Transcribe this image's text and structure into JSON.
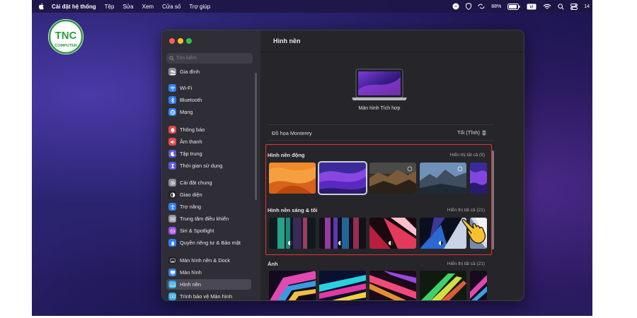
{
  "menubar": {
    "app_name": "Cài đặt hệ thống",
    "menus": [
      "Tệp",
      "Sửa",
      "Xem",
      "Cửa số",
      "Trợ giúp"
    ],
    "battery": "88%",
    "clock": "14"
  },
  "logo": {
    "text": "TNC",
    "sub": "COMPUTER",
    "color": "#2e9a3e"
  },
  "window": {
    "search_placeholder": "Tìm kiếm",
    "sidebar": [
      {
        "label": "Gia đình",
        "icon": "family-icon",
        "color": "#8e8e96"
      },
      {
        "label": "Wi-Fi",
        "icon": "wifi-icon",
        "color": "#2f7ff5"
      },
      {
        "label": "Bluetooth",
        "icon": "bluetooth-icon",
        "color": "#2f7ff5"
      },
      {
        "label": "Mạng",
        "icon": "globe-icon",
        "color": "#2f7ff5"
      },
      {
        "label": "Thông báo",
        "icon": "bell-icon",
        "color": "#e5484d"
      },
      {
        "label": "Âm thanh",
        "icon": "speaker-icon",
        "color": "#e5484d"
      },
      {
        "label": "Tập trung",
        "icon": "moon-icon",
        "color": "#5b5ce0"
      },
      {
        "label": "Thời gian sử dụng",
        "icon": "hourglass-icon",
        "color": "#5b5ce0"
      },
      {
        "label": "Cài đặt chung",
        "icon": "gear-icon",
        "color": "#8e8e96"
      },
      {
        "label": "Giao diện",
        "icon": "appearance-icon",
        "color": "#222226"
      },
      {
        "label": "Trợ năng",
        "icon": "accessibility-icon",
        "color": "#2f7ff5"
      },
      {
        "label": "Trung tâm điều khiển",
        "icon": "control-center-icon",
        "color": "#8e8e96"
      },
      {
        "label": "Siri & Spotlight",
        "icon": "siri-icon",
        "color": "#9b4de0"
      },
      {
        "label": "Quyền riêng tư & Bảo mật",
        "icon": "hand-icon",
        "color": "#2f7ff5"
      },
      {
        "label": "Màn hình nền & Dock",
        "icon": "dock-icon",
        "color": "#222226"
      },
      {
        "label": "Màn hình",
        "icon": "display-icon",
        "color": "#2f7ff5"
      },
      {
        "label": "Hình nền",
        "icon": "wallpaper-icon",
        "color": "#33a8e0"
      },
      {
        "label": "Trình bảo vệ Màn hình",
        "icon": "screensaver-icon",
        "color": "#33a8e0"
      }
    ],
    "active_item": "Hình nền",
    "main": {
      "title": "Hình nền",
      "display_name": "Màn hình Tích hợp",
      "setting_label": "Đồ họa Monterey",
      "setting_value": "Tối (Tĩnh)",
      "sections": [
        {
          "title": "Hình nền động",
          "show_all": "Hiển thị tất cả (9)"
        },
        {
          "title": "Hình nền sáng & tối",
          "show_all": "Hiển thị tất cả (21)"
        },
        {
          "title": "Ảnh",
          "show_all": "Hiển thị tất cả (21)"
        }
      ]
    }
  }
}
